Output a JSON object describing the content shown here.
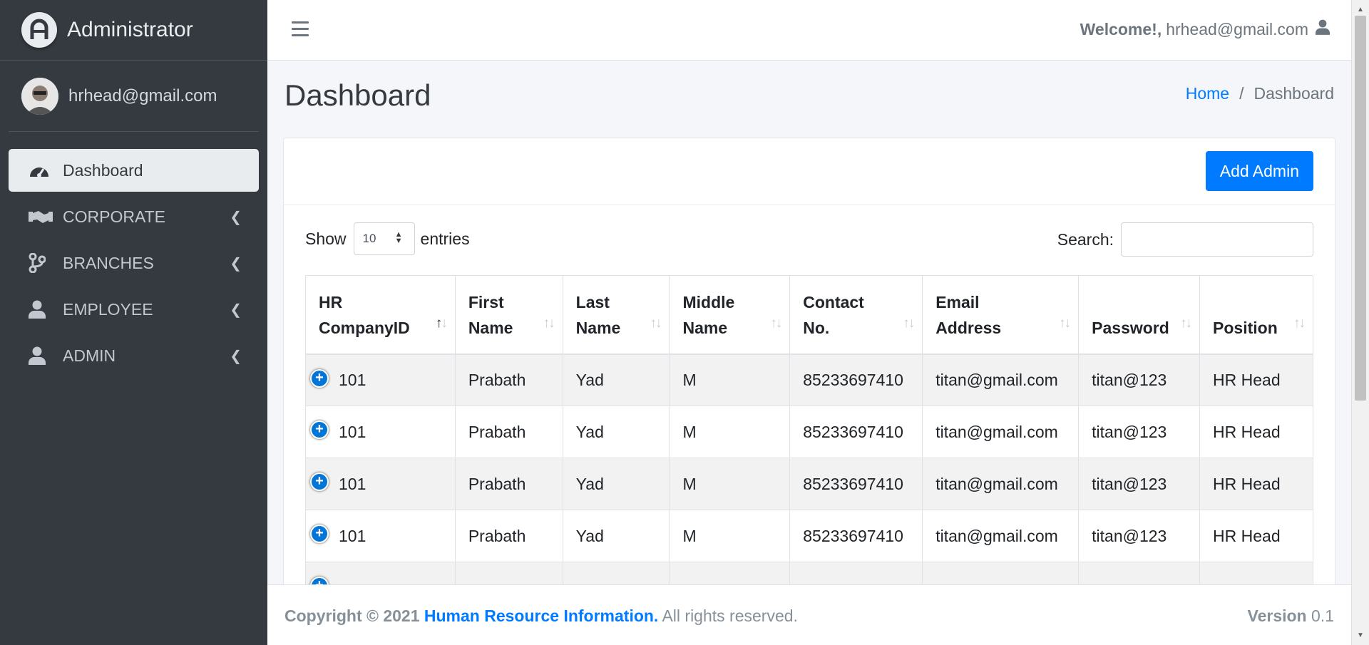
{
  "sidebar": {
    "brand": "Administrator",
    "user": "hrhead@gmail.com",
    "items": [
      {
        "label": "Dashboard",
        "icon": "tachometer-icon",
        "active": true
      },
      {
        "label": "CORPORATE",
        "icon": "handshake-icon"
      },
      {
        "label": "BRANCHES",
        "icon": "code-branch-icon"
      },
      {
        "label": "EMPLOYEE",
        "icon": "user-icon"
      },
      {
        "label": "ADMIN",
        "icon": "user-icon"
      }
    ]
  },
  "topbar": {
    "welcome_bold": "Welcome!,",
    "welcome_user": "hrhead@gmail.com"
  },
  "header": {
    "title": "Dashboard",
    "breadcrumb_home": "Home",
    "breadcrumb_sep": "/",
    "breadcrumb_current": "Dashboard"
  },
  "card": {
    "add_button": "Add Admin",
    "show_label": "Show",
    "entries_value": "10",
    "entries_label": "entries",
    "search_label": "Search:",
    "search_value": ""
  },
  "table": {
    "columns": [
      {
        "line1": "HR",
        "line2": "CompanyID"
      },
      {
        "line1": "First",
        "line2": "Name"
      },
      {
        "line1": "Last",
        "line2": "Name"
      },
      {
        "line1": "Middle",
        "line2": "Name"
      },
      {
        "line1": "Contact",
        "line2": "No."
      },
      {
        "line1": "Email",
        "line2": "Address"
      },
      {
        "line1": "",
        "line2": "Password"
      },
      {
        "line1": "",
        "line2": "Position"
      }
    ],
    "rows": [
      [
        "101",
        "Prabath",
        "Yad",
        "M",
        "85233697410",
        "titan@gmail.com",
        "titan@123",
        "HR Head"
      ],
      [
        "101",
        "Prabath",
        "Yad",
        "M",
        "85233697410",
        "titan@gmail.com",
        "titan@123",
        "HR Head"
      ],
      [
        "101",
        "Prabath",
        "Yad",
        "M",
        "85233697410",
        "titan@gmail.com",
        "titan@123",
        "HR Head"
      ],
      [
        "101",
        "Prabath",
        "Yad",
        "M",
        "85233697410",
        "titan@gmail.com",
        "titan@123",
        "HR Head"
      ]
    ]
  },
  "footer": {
    "copyright": "Copyright © 2021",
    "org": "Human Resource Information.",
    "rights": "All rights reserved.",
    "version_label": "Version",
    "version_value": "0.1"
  },
  "colors": {
    "sidebar_bg": "#343a40",
    "accent": "#007bff"
  }
}
